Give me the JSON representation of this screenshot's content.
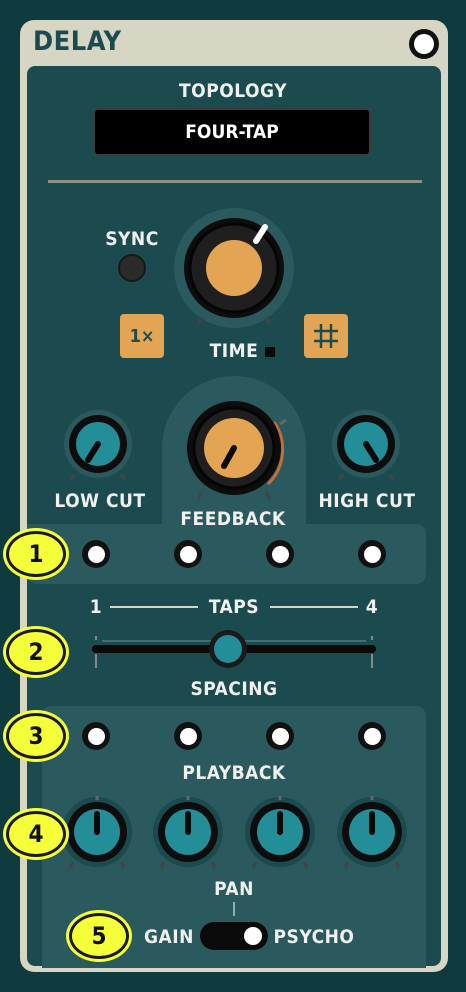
{
  "module": {
    "title": "DELAY",
    "power": "on"
  },
  "topology": {
    "label": "TOPOLOGY",
    "value": "FOUR-TAP"
  },
  "time_section": {
    "sync_label": "SYNC",
    "time_label": "TIME",
    "multiplier_label": "1×",
    "grid_icon": "grid-icon"
  },
  "filters": {
    "low_cut_label": "LOW CUT",
    "high_cut_label": "HIGH CUT",
    "feedback_label": "FEEDBACK"
  },
  "taps": {
    "label": "TAPS",
    "min": "1",
    "max": "4",
    "spacing_label": "SPACING"
  },
  "playback": {
    "label": "PLAYBACK",
    "pan_label": "PAN",
    "gain_label": "GAIN",
    "psycho_label": "PSYCHO"
  },
  "callouts": [
    "1",
    "2",
    "3",
    "4",
    "5"
  ],
  "colors": {
    "background": "#0f3b3e",
    "panel": "#d7d5c4",
    "inner": "#1c4b4f",
    "accent_orange": "#e3a554",
    "knob_teal": "#238e98",
    "callout_yellow": "#f4ff3a"
  }
}
